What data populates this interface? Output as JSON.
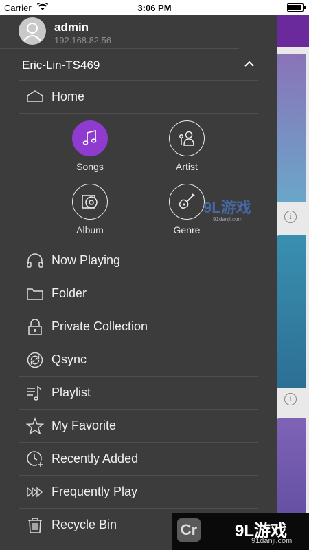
{
  "status": {
    "carrier": "Carrier",
    "time": "3:06 PM"
  },
  "user": {
    "name": "admin",
    "ip": "192.168.82.56"
  },
  "server": {
    "name": "Eric-Lin-TS469"
  },
  "home": {
    "label": "Home"
  },
  "grid": [
    {
      "label": "Songs",
      "icon": "music-note-icon",
      "active": true
    },
    {
      "label": "Artist",
      "icon": "artist-icon",
      "active": false
    },
    {
      "label": "Album",
      "icon": "album-icon",
      "active": false
    },
    {
      "label": "Genre",
      "icon": "guitar-icon",
      "active": false
    }
  ],
  "menu": [
    {
      "label": "Now Playing",
      "icon": "headphones-icon"
    },
    {
      "label": "Folder",
      "icon": "folder-icon"
    },
    {
      "label": "Private Collection",
      "icon": "lock-icon"
    },
    {
      "label": "Qsync",
      "icon": "sync-icon"
    },
    {
      "label": "Playlist",
      "icon": "playlist-icon"
    },
    {
      "label": "My Favorite",
      "icon": "star-icon"
    },
    {
      "label": "Recently Added",
      "icon": "clock-plus-icon"
    },
    {
      "label": "Frequently Play",
      "icon": "fast-forward-icon"
    },
    {
      "label": "Recycle Bin",
      "icon": "trash-icon"
    }
  ],
  "watermark": {
    "main": "9L游戏",
    "url": "91danji.com",
    "badge": "Cr"
  },
  "colors": {
    "drawer": "#3c3c3c",
    "accent": "#8f3bd0",
    "divider": "#4f4f4f"
  }
}
